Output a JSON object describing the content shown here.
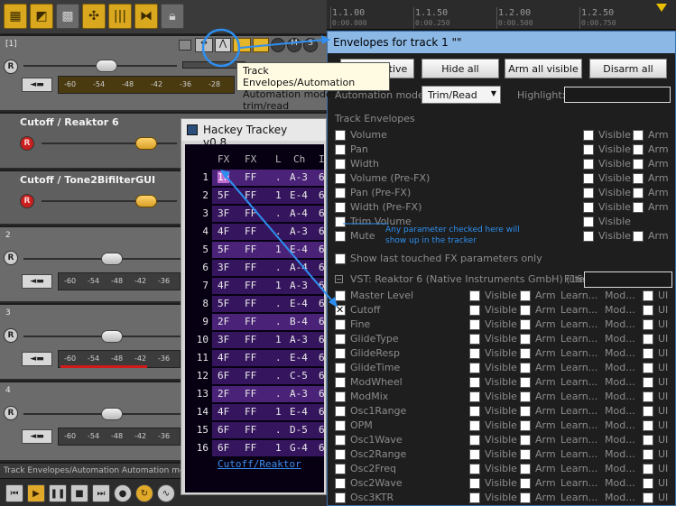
{
  "toolbar": {
    "icons": [
      "grid-snap-icon",
      "envelope-icon",
      "grid-icon",
      "ripple-icon",
      "item-lock-icon",
      "crossfade-icon",
      "lock-icon"
    ]
  },
  "timeline": {
    "major": [
      "1.1.00",
      "1.1.50",
      "1.2.00",
      "1.2.50"
    ],
    "minor": [
      "0:00.000",
      "0:00.250",
      "0:00.500",
      "0:00.750"
    ]
  },
  "tracks": {
    "track1_num": "[1]",
    "env1_label": "Cutoff / Reaktor 6",
    "env2_label": "Cutoff / Tone2BifilterGUI",
    "track2_num": "2",
    "track3_num": "3",
    "track4_num": "4",
    "meter_ticks": [
      "-60",
      "-54",
      "-48",
      "-42",
      "-36"
    ],
    "track1_meter": [
      "-60",
      "-54",
      "-48",
      "-42",
      "-36",
      "-28"
    ],
    "rec_label": "R",
    "io_label": "◄▬"
  },
  "tooltip": {
    "line1": "Track Envelopes/Automation",
    "line2": "Automation mode: trim/read"
  },
  "envelopes": {
    "title": "Envelopes for track 1 \"\"",
    "buttons": {
      "show_active": "Show active",
      "hide_all": "Hide all",
      "arm_all_visible": "Arm all visible",
      "disarm_all": "Disarm all"
    },
    "automation_mode_label": "Automation mode:",
    "automation_mode_value": "Trim/Read",
    "highlight_label": "Highlight:",
    "track_envelopes_heading": "Track Envelopes",
    "track_envelopes": [
      "Volume",
      "Pan",
      "Width",
      "Volume (Pre-FX)",
      "Pan (Pre-FX)",
      "Width (Pre-FX)",
      "Trim Volume",
      "Mute"
    ],
    "col_visible": "Visible",
    "col_arm": "Arm",
    "show_last_touched": "Show last touched FX parameters only",
    "vst_heading": "VST: Reaktor 6 (Native Instruments GmbH) (16c",
    "filter_label": "Filter:",
    "col_learn": "Learn...",
    "col_mod": "Mod...",
    "col_ui": "UI",
    "vst_params": [
      "Master Level",
      "Cutoff",
      "Fine",
      "GlideType",
      "GlideResp",
      "GlideTime",
      "ModWheel",
      "ModMix",
      "Osc1Range",
      "OPM",
      "Osc1Wave",
      "Osc2Range",
      "Osc2Freq",
      "Osc2Wave",
      "Osc3KTR"
    ]
  },
  "tracker": {
    "title": "Hackey Trackey v0.8",
    "headers": [
      "FX",
      "FX",
      "L",
      "Ch",
      "I"
    ],
    "rows": [
      {
        "n": "1",
        "fx1": "1F",
        "fx2": "FF",
        "l": ".",
        "note": "A-3",
        "tail": "6"
      },
      {
        "n": "2",
        "fx1": "5F",
        "fx2": "FF",
        "l": "1",
        "note": "E-4",
        "tail": "6"
      },
      {
        "n": "3",
        "fx1": "3F",
        "fx2": "FF",
        "l": ".",
        "note": "A-4",
        "tail": "6"
      },
      {
        "n": "4",
        "fx1": "4F",
        "fx2": "FF",
        "l": ".",
        "note": "A-3",
        "tail": "6"
      },
      {
        "n": "5",
        "fx1": "5F",
        "fx2": "FF",
        "l": "1",
        "note": "E-4",
        "tail": "6"
      },
      {
        "n": "6",
        "fx1": "3F",
        "fx2": "FF",
        "l": ".",
        "note": "A-4",
        "tail": "6"
      },
      {
        "n": "7",
        "fx1": "4F",
        "fx2": "FF",
        "l": "1",
        "note": "A-3",
        "tail": "6"
      },
      {
        "n": "8",
        "fx1": "5F",
        "fx2": "FF",
        "l": ".",
        "note": "E-4",
        "tail": "6"
      },
      {
        "n": "9",
        "fx1": "2F",
        "fx2": "FF",
        "l": ".",
        "note": "B-4",
        "tail": "6"
      },
      {
        "n": "10",
        "fx1": "3F",
        "fx2": "FF",
        "l": "1",
        "note": "A-3",
        "tail": "6"
      },
      {
        "n": "11",
        "fx1": "4F",
        "fx2": "FF",
        "l": ".",
        "note": "E-4",
        "tail": "6"
      },
      {
        "n": "12",
        "fx1": "6F",
        "fx2": "FF",
        "l": ".",
        "note": "C-5",
        "tail": "6"
      },
      {
        "n": "13",
        "fx1": "2F",
        "fx2": "FF",
        "l": ".",
        "note": "A-3",
        "tail": "6"
      },
      {
        "n": "14",
        "fx1": "4F",
        "fx2": "FF",
        "l": "1",
        "note": "E-4",
        "tail": "6"
      },
      {
        "n": "15",
        "fx1": "6F",
        "fx2": "FF",
        "l": ".",
        "note": "D-5",
        "tail": "6"
      },
      {
        "n": "16",
        "fx1": "6F",
        "fx2": "FF",
        "l": "1",
        "note": "G-4",
        "tail": "6"
      }
    ],
    "footer": "Cutoff/Reaktor"
  },
  "annotation": "Any parameter checked here will show up in the tracker",
  "statusbar": "Track Envelopes/Automation  Automation mode",
  "transport": {
    "buttons": [
      "skip-back-icon",
      "play-icon",
      "pause-icon",
      "stop-icon",
      "record-icon",
      "loop-icon",
      "metronome-icon"
    ]
  },
  "colors": {
    "accent_blue": "#2e8ff0",
    "gold": "#d9a81f",
    "tracker_bg": "#060012",
    "tracker_row": "#35165e"
  }
}
